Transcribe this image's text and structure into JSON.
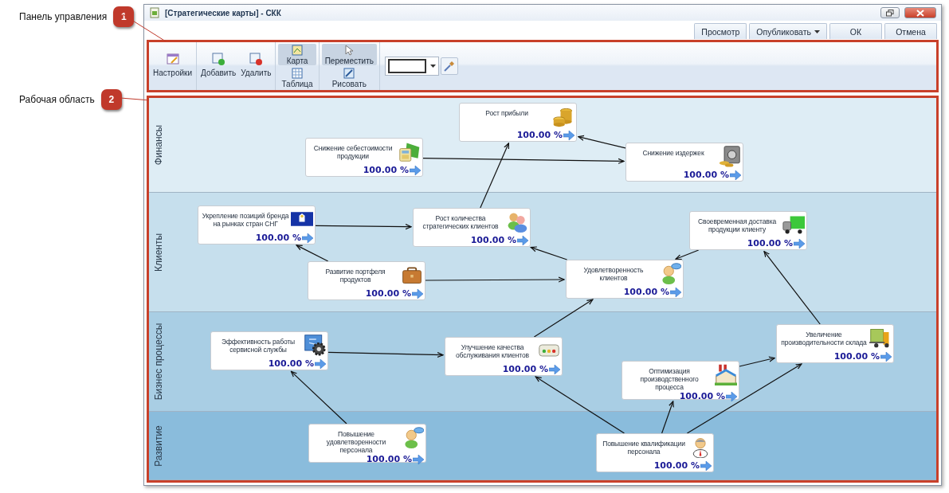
{
  "callouts": [
    {
      "number": "1",
      "label": "Панель управления"
    },
    {
      "number": "2",
      "label": "Рабочая область"
    }
  ],
  "window": {
    "title": "[Стратегические карты] - СКК"
  },
  "action_buttons": [
    {
      "label": "Просмотр",
      "dropdown": false
    },
    {
      "label": "Опубликовать",
      "dropdown": true
    },
    {
      "label": "ОК",
      "dropdown": false
    },
    {
      "label": "Отмена",
      "dropdown": false
    }
  ],
  "toolbar": {
    "settings": "Настройки",
    "add": "Добавить",
    "remove": "Удалить",
    "view_modes": [
      {
        "label": "Карта",
        "selected": true
      },
      {
        "label": "Таблица",
        "selected": false
      }
    ],
    "tools": [
      {
        "label": "Переместить",
        "selected": true
      },
      {
        "label": "Рисовать",
        "selected": false
      }
    ]
  },
  "lanes": [
    {
      "label": "Финансы"
    },
    {
      "label": "Клиенты"
    },
    {
      "label": "Бизнес процессы"
    },
    {
      "label": "Развитие"
    }
  ],
  "nodes": [
    {
      "title": "Рост прибыли",
      "value": "100.00 %"
    },
    {
      "title": "Снижение себестоимости продукции",
      "value": "100.00 %"
    },
    {
      "title": "Снижение издержек",
      "value": "100.00 %"
    },
    {
      "title": "Укрепление позиций бренда на рынках стран СНГ",
      "value": "100.00 %"
    },
    {
      "title": "Рост количества стратегических клиентов",
      "value": "100.00 %"
    },
    {
      "title": "Своевременная доставка продукции клиенту",
      "value": "100.00 %"
    },
    {
      "title": "Развитие портфеля продуктов",
      "value": "100.00 %"
    },
    {
      "title": "Удовлетворенность клиентов",
      "value": "100.00 %"
    },
    {
      "title": "Эффективность работы сервисной службы",
      "value": "100.00 %"
    },
    {
      "title": "Улучшение качества обслуживания клиентов",
      "value": "100.00 %"
    },
    {
      "title": "Увеличение производительности склада",
      "value": "100.00 %"
    },
    {
      "title": "Оптимизация производственного процесса",
      "value": "100.00 %"
    },
    {
      "title": "Повышение удовлетворенности персонала",
      "value": "100.00 %"
    },
    {
      "title": "Повышение квалификации персонала",
      "value": "100.00 %"
    }
  ]
}
